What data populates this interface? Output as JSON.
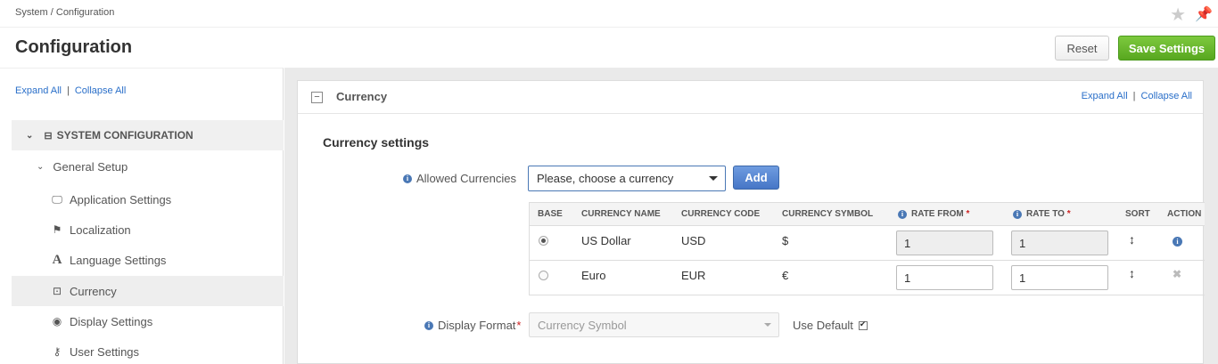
{
  "breadcrumb": {
    "root": "System",
    "separator": "/",
    "current": "Configuration"
  },
  "header": {
    "title": "Configuration",
    "reset_label": "Reset",
    "save_label": "Save Settings"
  },
  "sidebar": {
    "expand_all": "Expand All",
    "separator": "|",
    "collapse_all": "Collapse All",
    "system_configuration": "SYSTEM CONFIGURATION",
    "general_setup": "General Setup",
    "items": [
      {
        "label": "Application Settings",
        "icon": "monitor-icon",
        "active": false
      },
      {
        "label": "Localization",
        "icon": "flag-icon",
        "active": false
      },
      {
        "label": "Language Settings",
        "icon": "font-icon",
        "active": false
      },
      {
        "label": "Currency",
        "icon": "money-icon",
        "active": true
      },
      {
        "label": "Display Settings",
        "icon": "eye-icon",
        "active": false
      },
      {
        "label": "User Settings",
        "icon": "key-icon",
        "active": false
      }
    ]
  },
  "panel": {
    "collapse_glyph": "−",
    "title": "Currency",
    "expand_all": "Expand All",
    "separator": "|",
    "collapse_all": "Collapse All",
    "section_title": "Currency settings",
    "allowed_currencies_label": "Allowed Currencies",
    "currency_select_value": "Please, choose a currency",
    "add_label": "Add",
    "table": {
      "headers": {
        "base": "BASE",
        "name": "CURRENCY NAME",
        "code": "CURRENCY CODE",
        "symbol": "CURRENCY SYMBOL",
        "rate_from": "RATE FROM",
        "rate_to": "RATE TO",
        "required_mark": "*",
        "sort": "SORT",
        "action": "ACTION"
      },
      "rows": [
        {
          "base": true,
          "name": "US Dollar",
          "code": "USD",
          "symbol": "$",
          "rate_from": "1",
          "rate_to": "1",
          "sort": "↕",
          "action": "info"
        },
        {
          "base": false,
          "name": "Euro",
          "code": "EUR",
          "symbol": "€",
          "rate_from": "1",
          "rate_to": "1",
          "sort": "↕",
          "action": "delete"
        }
      ]
    },
    "display_format_label": "Display Format",
    "display_format_required": "*",
    "display_format_value": "Currency Symbol",
    "use_default_label": "Use Default",
    "use_default_checked": true
  },
  "colors": {
    "accent": "#4a78b5",
    "save_green": "#58a71f",
    "link": "#2a6fc9"
  }
}
